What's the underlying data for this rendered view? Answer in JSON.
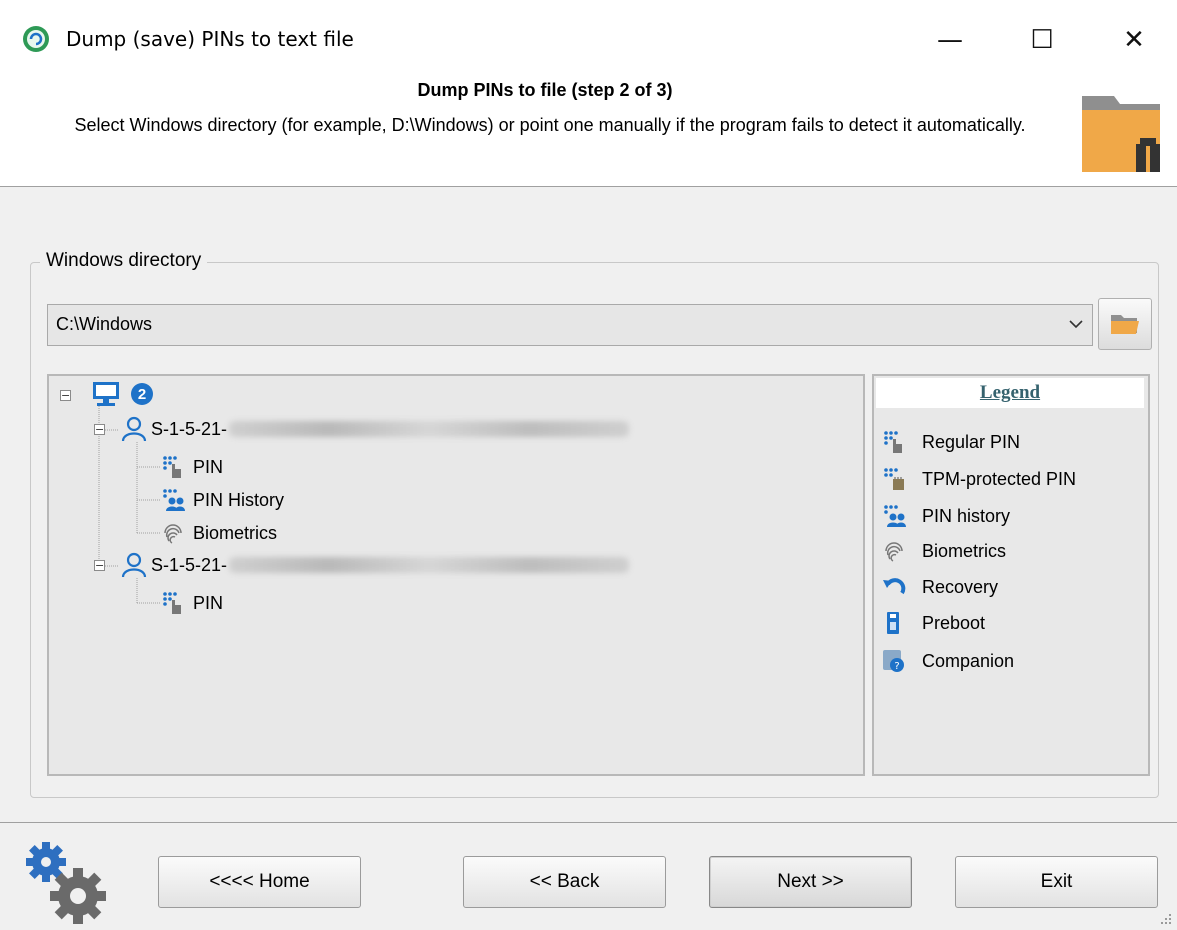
{
  "window": {
    "title": "Dump (save) PINs to text file",
    "minimize_glyph": "—",
    "maximize_glyph": "☐",
    "close_glyph": "✕"
  },
  "header": {
    "title": "Dump PINs to file (step 2 of 3)",
    "description": "Select Windows directory (for example, D:\\Windows) or point one manually if the program fails to detect it automatically.",
    "icon": "folder-binoculars-icon"
  },
  "group": {
    "label": "Windows directory",
    "combo_value": "C:\\Windows",
    "browse_icon": "folder-open-icon"
  },
  "tree": {
    "root_badge": "2",
    "users": [
      {
        "sid_prefix": "S-1-5-21-",
        "children": [
          "PIN",
          "PIN History",
          "Biometrics"
        ]
      },
      {
        "sid_prefix": "S-1-5-21-",
        "children": [
          "PIN"
        ]
      }
    ]
  },
  "legend": {
    "title": "Legend",
    "items": [
      {
        "label": "Regular PIN",
        "icon": "regular-pin-icon"
      },
      {
        "label": "TPM-protected PIN",
        "icon": "tpm-pin-icon"
      },
      {
        "label": "PIN history",
        "icon": "pin-history-icon"
      },
      {
        "label": "Biometrics",
        "icon": "fingerprint-icon"
      },
      {
        "label": "Recovery",
        "icon": "recovery-icon"
      },
      {
        "label": "Preboot",
        "icon": "preboot-icon"
      },
      {
        "label": "Companion",
        "icon": "companion-icon"
      }
    ]
  },
  "buttons": {
    "home": "<<<< Home",
    "back": "<< Back",
    "next": "Next >>",
    "exit": "Exit"
  },
  "colors": {
    "accent_blue": "#1e72c8",
    "folder_orange": "#f0a848",
    "legend_title": "#35626e"
  }
}
